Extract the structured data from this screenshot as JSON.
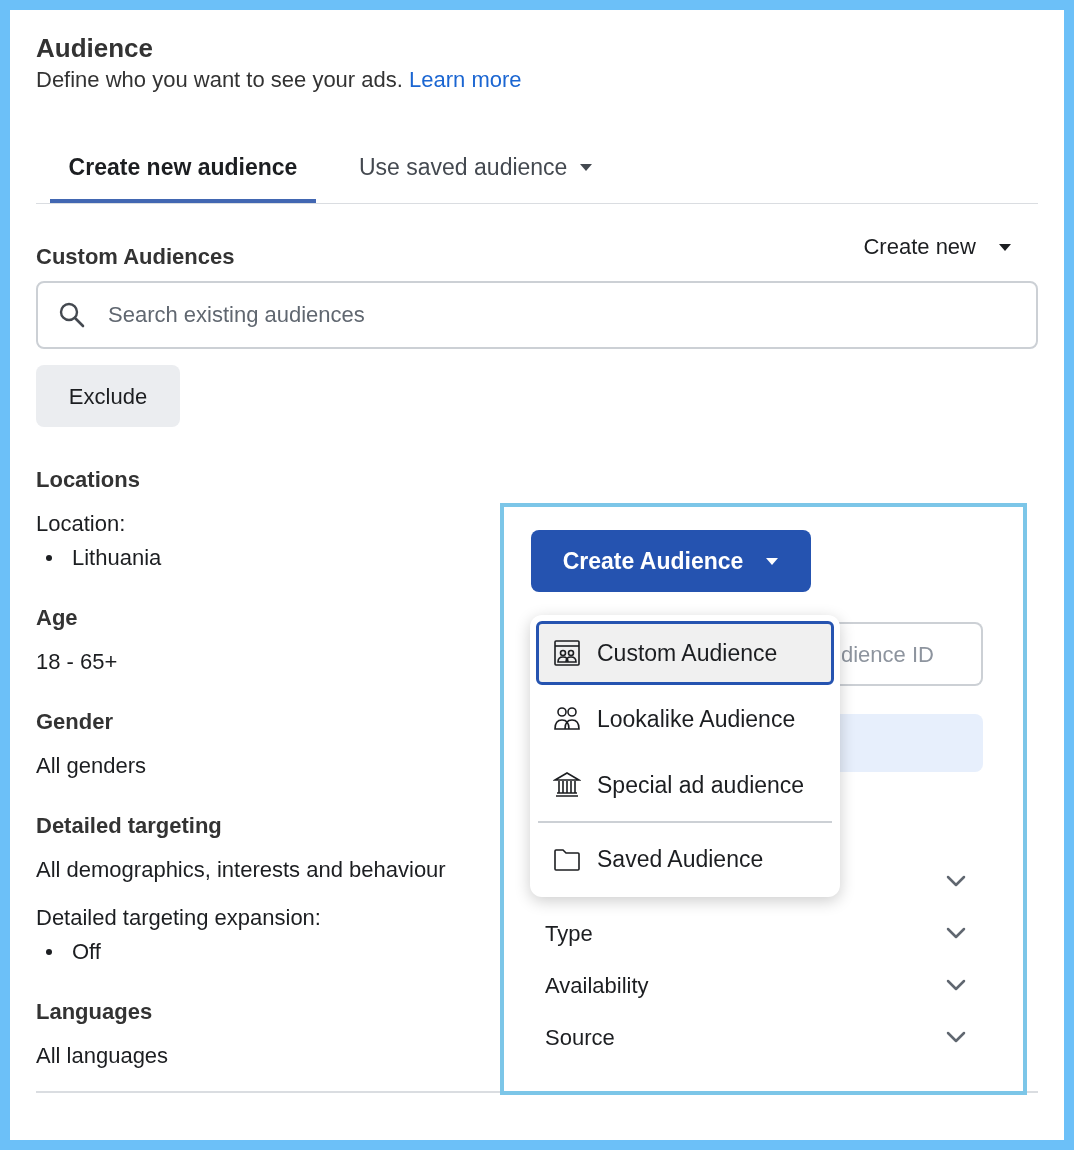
{
  "header": {
    "title": "Audience",
    "description": "Define who you want to see your ads.",
    "link": "Learn more"
  },
  "tabs": [
    {
      "label": "Create new audience",
      "selected": true,
      "dropdown": false
    },
    {
      "label": "Use saved audience",
      "selected": false,
      "dropdown": true
    }
  ],
  "custom_audiences": {
    "title": "Custom Audiences",
    "create_menu": "Create new",
    "search": {
      "placeholder": "Search existing audiences"
    },
    "exclude_button": "Exclude"
  },
  "sections": [
    {
      "title": "Locations",
      "lines": [
        {
          "kind": "label",
          "text": "Location:"
        },
        {
          "kind": "bullet",
          "text": "Lithuania"
        }
      ]
    },
    {
      "title": "Age",
      "lines": [
        {
          "kind": "text",
          "text": "18 - 65+"
        }
      ]
    },
    {
      "title": "Gender",
      "lines": [
        {
          "kind": "text",
          "text": "All genders"
        }
      ]
    },
    {
      "title": "Detailed targeting",
      "lines": [
        {
          "kind": "text",
          "text": "All demographics, interests and behaviour"
        },
        {
          "kind": "label",
          "text": "Detailed targeting expansion:"
        },
        {
          "kind": "bullet",
          "text": "Off"
        }
      ]
    },
    {
      "title": "Languages",
      "lines": [
        {
          "kind": "text",
          "text": "All languages"
        }
      ]
    }
  ],
  "panel": {
    "button": "Create Audience",
    "id_field": {
      "placeholder": "dience ID"
    },
    "menu": [
      {
        "label": "Custom Audience",
        "selected": true,
        "kind": "custom",
        "divider_before": false
      },
      {
        "label": "Lookalike Audience",
        "selected": false,
        "kind": "lookalike",
        "divider_before": false
      },
      {
        "label": "Special ad audience",
        "selected": false,
        "kind": "special",
        "divider_before": false
      },
      {
        "label": "Saved Audience",
        "selected": false,
        "kind": "saved",
        "divider_before": true
      }
    ],
    "filters": [
      {
        "label": "Type"
      },
      {
        "label": "Availability"
      },
      {
        "label": "Source"
      }
    ]
  }
}
